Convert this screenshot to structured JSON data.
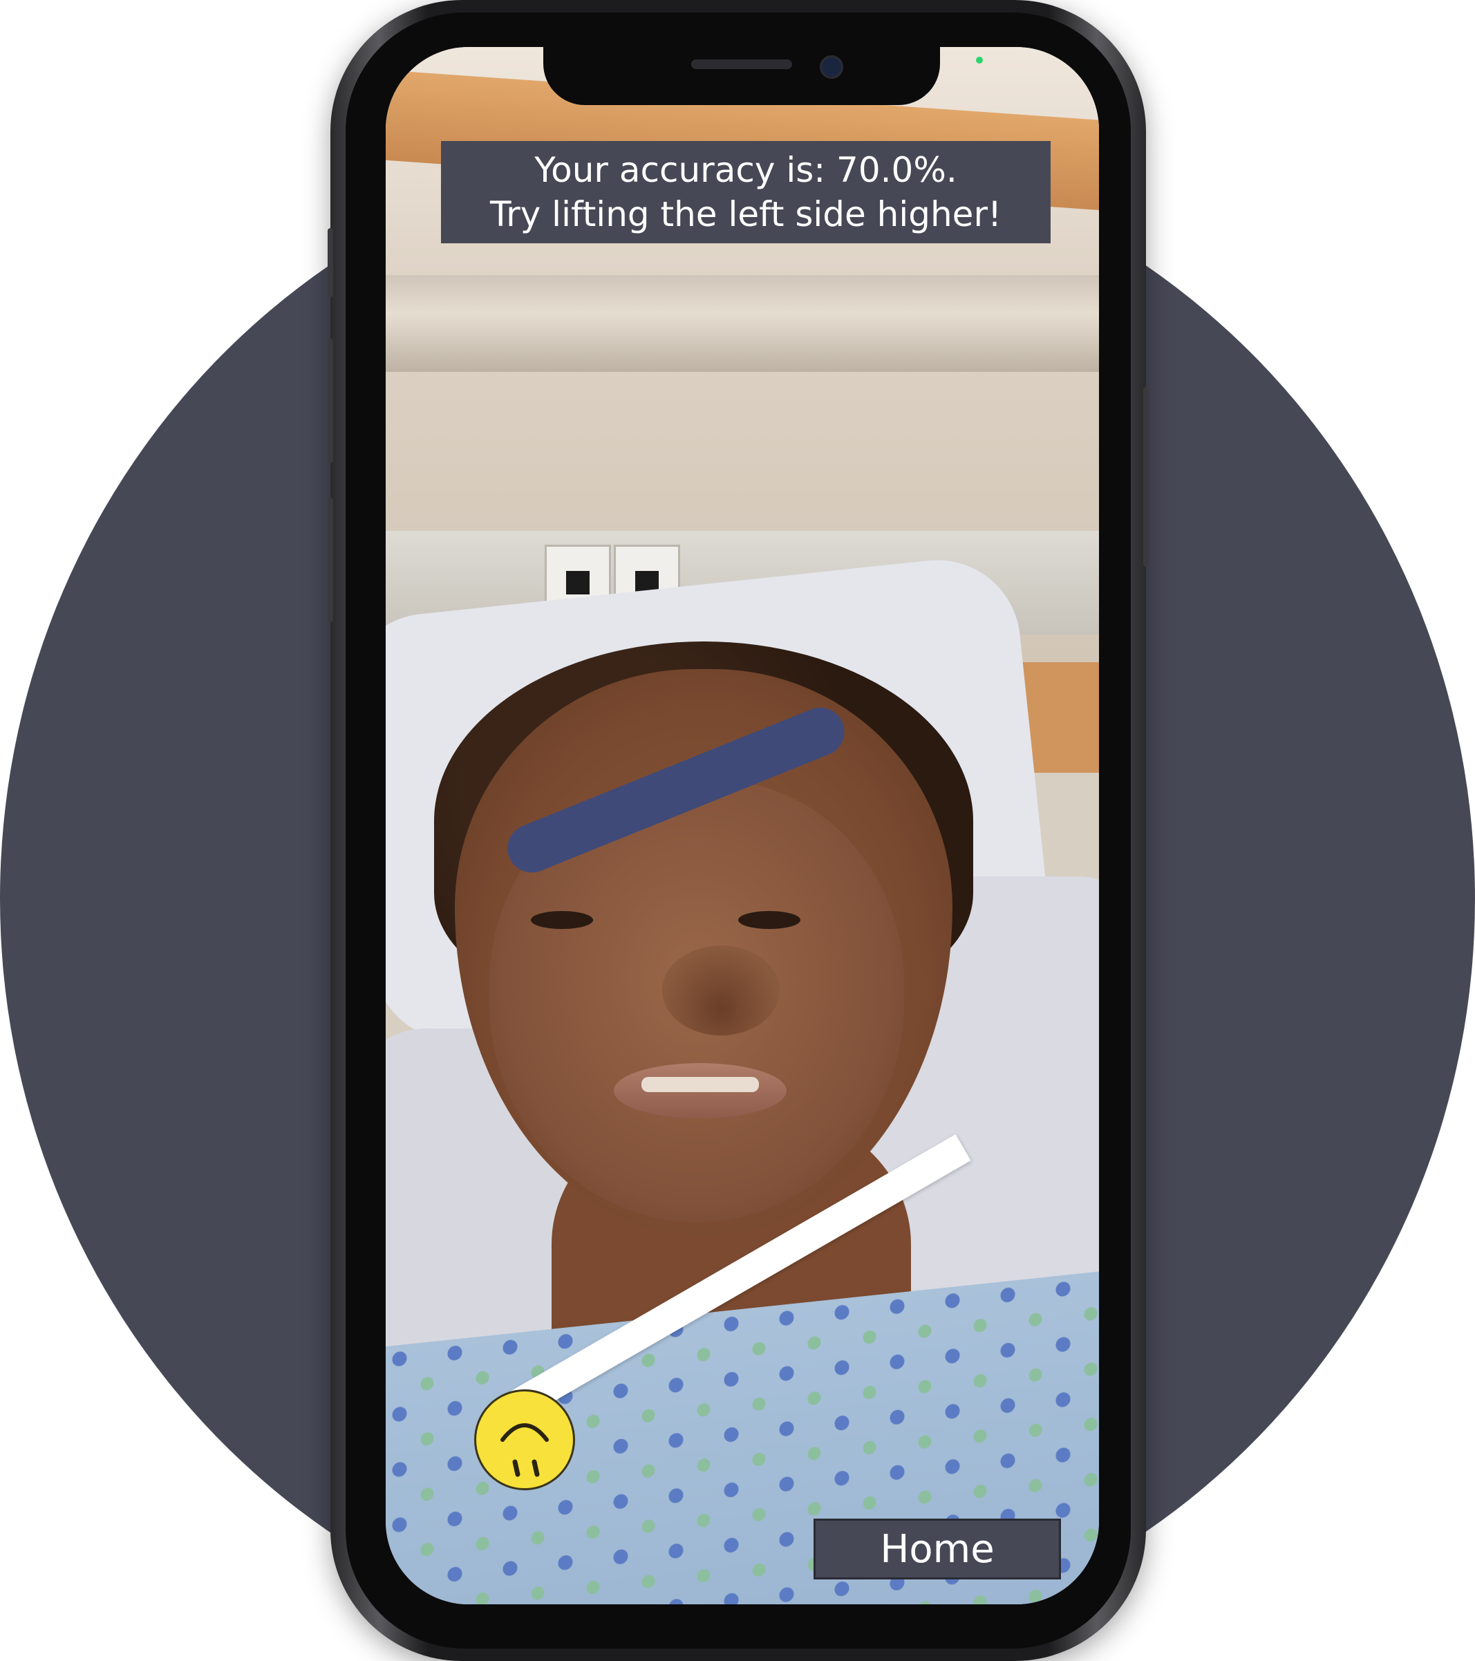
{
  "overlay": {
    "accuracy_line": "Your accuracy is: 70.0%.",
    "hint_line": "Try lifting the left side higher!",
    "home_label": "Home"
  },
  "icons": {
    "smiley": "smiley-face-icon",
    "target": "target-line-icon"
  },
  "colors": {
    "background_circle": "#474856",
    "banner_bg": "#474856",
    "banner_text": "#ffffff",
    "smiley": "#f7e13a",
    "target_bar": "#ffffff",
    "camera_indicator": "#2bd46a"
  }
}
